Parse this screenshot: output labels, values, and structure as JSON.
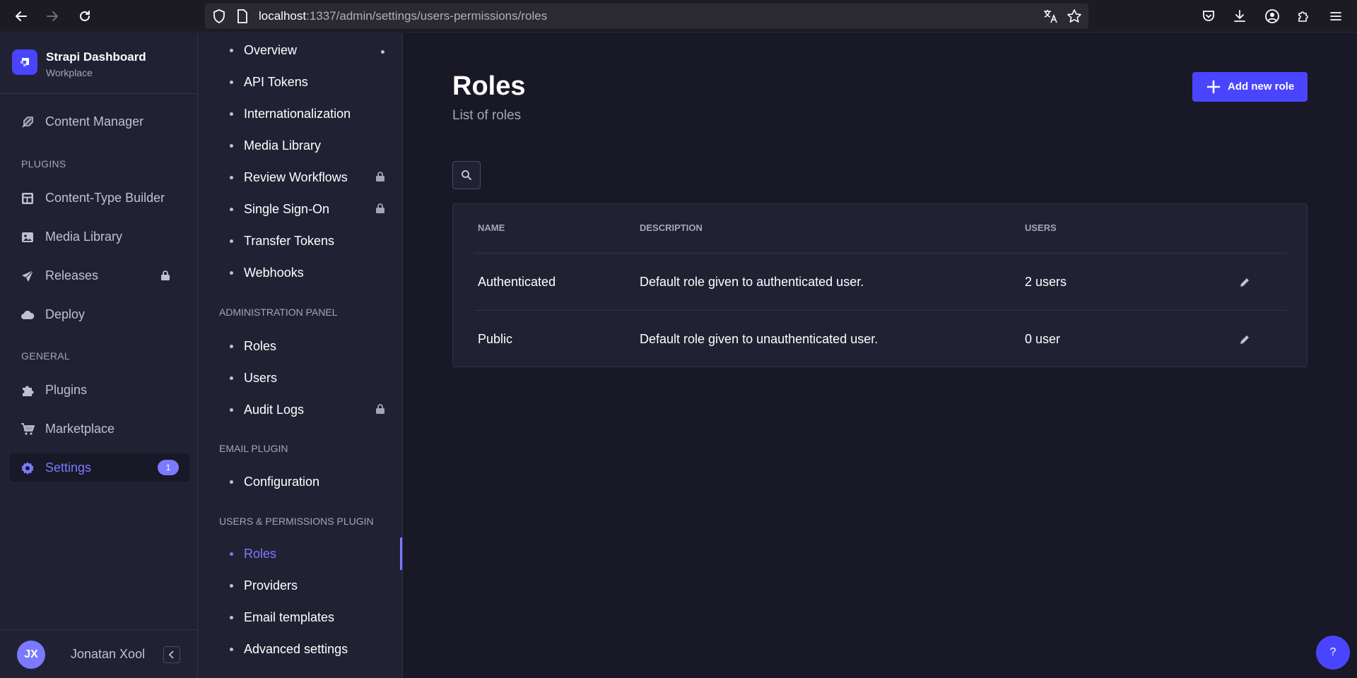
{
  "browser": {
    "url_host": "localhost",
    "url_path": ":1337/admin/settings/users-permissions/roles"
  },
  "brand": {
    "title": "Strapi Dashboard",
    "subtitle": "Workplace"
  },
  "main_nav": {
    "content_manager": "Content Manager",
    "plugins_section": "PLUGINS",
    "content_type_builder": "Content-Type Builder",
    "media_library": "Media Library",
    "releases": "Releases",
    "deploy": "Deploy",
    "general_section": "GENERAL",
    "plugins": "Plugins",
    "marketplace": "Marketplace",
    "settings": "Settings",
    "settings_badge": "1"
  },
  "user": {
    "initials": "JX",
    "name": "Jonatan Xool"
  },
  "sub_nav": {
    "global": [
      "Overview",
      "API Tokens",
      "Internationalization",
      "Media Library",
      "Review Workflows",
      "Single Sign-On",
      "Transfer Tokens",
      "Webhooks"
    ],
    "admin_section": "ADMINISTRATION PANEL",
    "admin": [
      "Roles",
      "Users",
      "Audit Logs"
    ],
    "email_section": "EMAIL PLUGIN",
    "email": [
      "Configuration"
    ],
    "up_section": "USERS & PERMISSIONS PLUGIN",
    "up": [
      "Roles",
      "Providers",
      "Email templates",
      "Advanced settings"
    ]
  },
  "page": {
    "title": "Roles",
    "subtitle": "List of roles",
    "add_button": "Add new role"
  },
  "table": {
    "headers": {
      "name": "NAME",
      "description": "DESCRIPTION",
      "users": "USERS"
    },
    "rows": [
      {
        "name": "Authenticated",
        "description": "Default role given to authenticated user.",
        "users": "2 users"
      },
      {
        "name": "Public",
        "description": "Default role given to unauthenticated user.",
        "users": "0 user"
      }
    ]
  },
  "help": "?",
  "colors": {
    "primary": "#4945ff",
    "accent": "#7b79ff",
    "background": "#181826",
    "panel": "#212134"
  }
}
